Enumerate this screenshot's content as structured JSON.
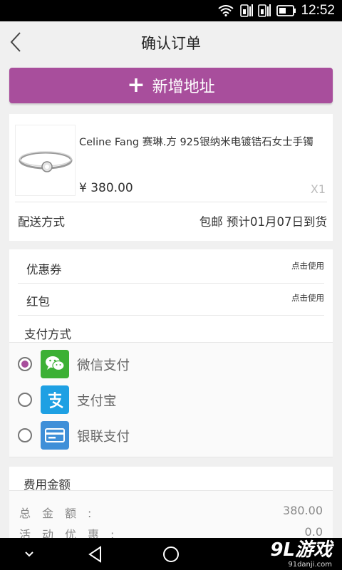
{
  "status_bar": {
    "time": "12:52"
  },
  "nav": {
    "title": "确认订单"
  },
  "add_address": {
    "label": "新增地址"
  },
  "product": {
    "name": "Celine Fang 赛琳.方 925银纳米电镀锆石女士手镯",
    "price": "¥ 380.00",
    "quantity": "X1",
    "shipping_label": "配送方式",
    "shipping_value": "包邮  预计01月07日到货"
  },
  "options": {
    "coupon_label": "优惠券",
    "coupon_action": "点击使用",
    "redpacket_label": "红包",
    "redpacket_action": "点击使用",
    "payment_title": "支付方式",
    "payment_methods": [
      {
        "label": "微信支付",
        "icon": "wechat-icon",
        "color": "#3cb034",
        "selected": true
      },
      {
        "label": "支付宝",
        "icon": "alipay-icon",
        "color": "#1ea0e3",
        "selected": false
      },
      {
        "label": "银联支付",
        "icon": "unionpay-card-icon",
        "color": "#3f8fd8",
        "selected": false
      }
    ]
  },
  "fees": {
    "title": "费用金额",
    "total_label": "总金额:",
    "total_value": "380.00",
    "discount_label": "活动优惠:",
    "discount_value": "0.0"
  },
  "watermark": {
    "brand": "9L游戏",
    "site": "91danji.com"
  },
  "accent_color": "#a84e9c"
}
